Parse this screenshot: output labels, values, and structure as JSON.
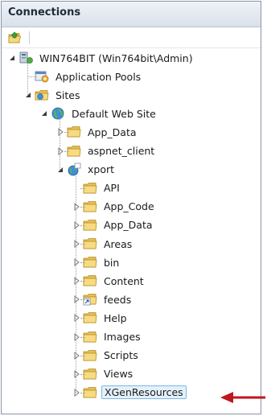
{
  "panel": {
    "title": "Connections"
  },
  "toolbar": {
    "connect_icon": "connect-icon"
  },
  "tree": {
    "server": {
      "label": "WIN764BIT (Win764bit\\Admin)",
      "icon": "server-icon"
    },
    "app_pools": {
      "label": "Application Pools",
      "icon": "app-pools-icon"
    },
    "sites": {
      "label": "Sites",
      "icon": "sites-icon"
    },
    "default_site": {
      "label": "Default Web Site",
      "icon": "globe-icon"
    },
    "default_children": [
      {
        "label": "App_Data",
        "icon": "folder-icon"
      },
      {
        "label": "aspnet_client",
        "icon": "folder-icon"
      }
    ],
    "xport": {
      "label": "xport",
      "icon": "web-app-icon"
    },
    "xport_children": [
      {
        "label": "API",
        "icon": "folder-icon",
        "expandable": false
      },
      {
        "label": "App_Code",
        "icon": "folder-icon",
        "expandable": true
      },
      {
        "label": "App_Data",
        "icon": "folder-icon",
        "expandable": true
      },
      {
        "label": "Areas",
        "icon": "folder-icon",
        "expandable": true
      },
      {
        "label": "bin",
        "icon": "folder-icon",
        "expandable": true
      },
      {
        "label": "Content",
        "icon": "folder-icon",
        "expandable": true
      },
      {
        "label": "feeds",
        "icon": "virtual-dir-icon",
        "expandable": true
      },
      {
        "label": "Help",
        "icon": "folder-icon",
        "expandable": true
      },
      {
        "label": "Images",
        "icon": "folder-icon",
        "expandable": true
      },
      {
        "label": "Scripts",
        "icon": "folder-icon",
        "expandable": true
      },
      {
        "label": "Views",
        "icon": "folder-icon",
        "expandable": true
      },
      {
        "label": "XGenResources",
        "icon": "folder-icon",
        "expandable": true,
        "selected": true
      }
    ]
  },
  "annotation": {
    "arrow_color": "#c0161c"
  }
}
